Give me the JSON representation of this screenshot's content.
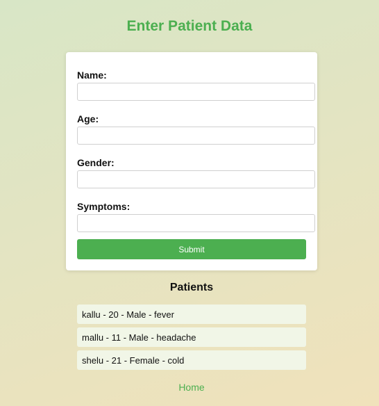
{
  "header": {
    "title": "Enter Patient Data"
  },
  "form": {
    "fields": [
      {
        "label": "Name:",
        "value": "",
        "placeholder": ""
      },
      {
        "label": "Age:",
        "value": "",
        "placeholder": ""
      },
      {
        "label": "Gender:",
        "value": "",
        "placeholder": ""
      },
      {
        "label": "Symptoms:",
        "value": "",
        "placeholder": ""
      }
    ],
    "submit_label": "Submit"
  },
  "patients": {
    "heading": "Patients",
    "items": [
      "kallu - 20 - Male - fever",
      "mallu - 11 - Male - headache",
      "shelu - 21 - Female - cold"
    ]
  },
  "footer": {
    "home_label": "Home"
  },
  "colors": {
    "accent": "#4caf50",
    "list_item_bg": "#f1f6e7"
  }
}
